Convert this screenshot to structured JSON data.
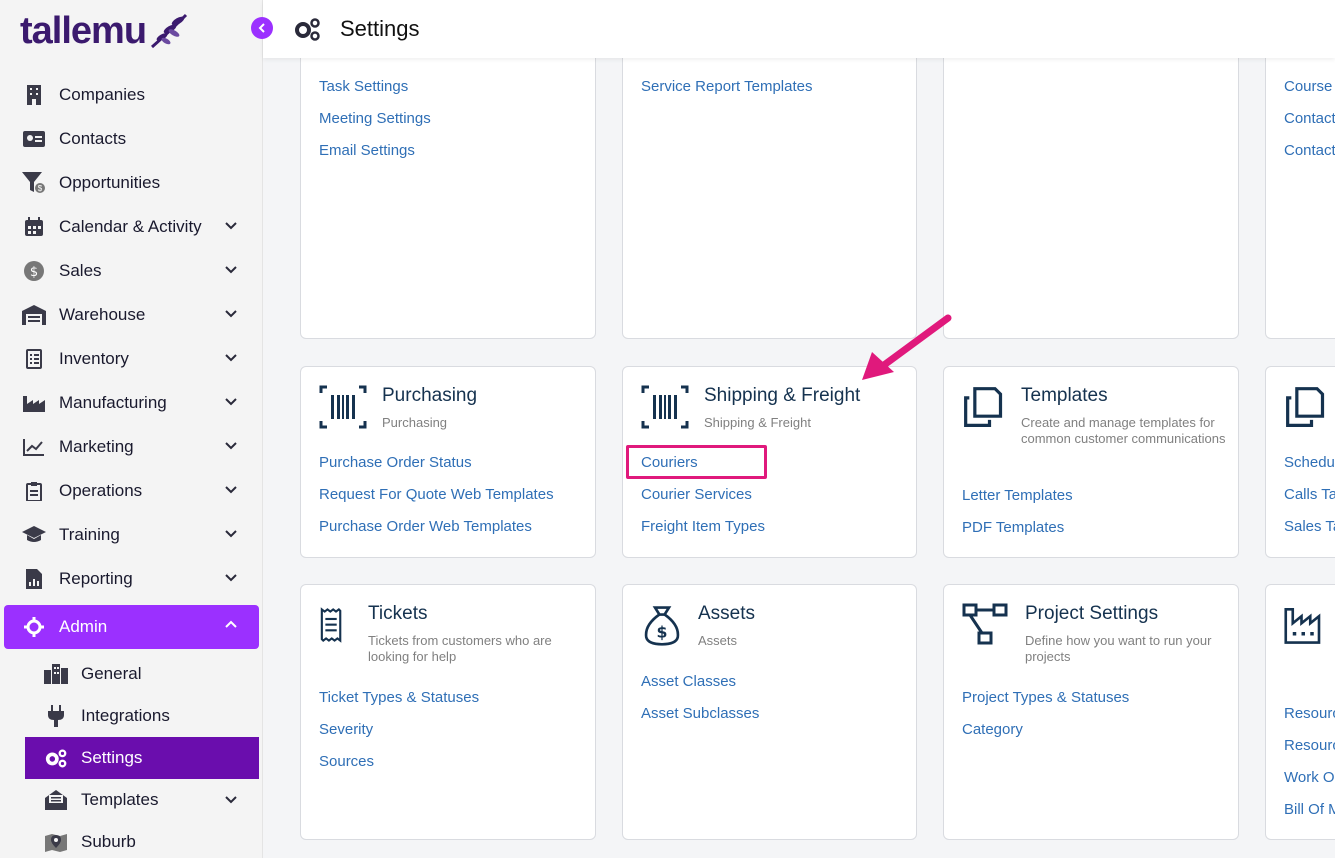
{
  "app": {
    "logo": "tallemu",
    "header_title": "Settings"
  },
  "sidebar": {
    "items": [
      {
        "label": "Companies",
        "icon": "building-icon",
        "expandable": false
      },
      {
        "label": "Contacts",
        "icon": "id-card-icon",
        "expandable": false
      },
      {
        "label": "Opportunities",
        "icon": "funnel-icon",
        "expandable": false
      },
      {
        "label": "Calendar & Activity",
        "icon": "calendar-icon",
        "expandable": true
      },
      {
        "label": "Sales",
        "icon": "dollar-coin-icon",
        "expandable": true
      },
      {
        "label": "Warehouse",
        "icon": "warehouse-icon",
        "expandable": true
      },
      {
        "label": "Inventory",
        "icon": "checklist-icon",
        "expandable": true
      },
      {
        "label": "Manufacturing",
        "icon": "factory-icon",
        "expandable": true
      },
      {
        "label": "Marketing",
        "icon": "trend-chart-icon",
        "expandable": true
      },
      {
        "label": "Operations",
        "icon": "clipboard-icon",
        "expandable": true
      },
      {
        "label": "Training",
        "icon": "graduation-cap-icon",
        "expandable": true
      },
      {
        "label": "Reporting",
        "icon": "report-icon",
        "expandable": true
      }
    ],
    "admin": {
      "label": "Admin",
      "icon": "cog-icon"
    },
    "admin_sub": [
      {
        "label": "General",
        "icon": "city-icon"
      },
      {
        "label": "Integrations",
        "icon": "plug-icon"
      },
      {
        "label": "Settings",
        "icon": "gears-icon"
      },
      {
        "label": "Templates",
        "icon": "envelope-open-icon"
      },
      {
        "label": "Suburb",
        "icon": "map-marker-icon"
      }
    ]
  },
  "cards": {
    "top1": {
      "links": [
        "Task Settings",
        "Meeting Settings",
        "Email Settings"
      ]
    },
    "top2": {
      "links": [
        "Service Report Templates"
      ]
    },
    "top4": {
      "links": [
        "Course",
        "Contact",
        "Contact"
      ]
    },
    "purchasing": {
      "title": "Purchasing",
      "subtitle": "Purchasing",
      "links": [
        "Purchase Order Status",
        "Request For Quote Web Templates",
        "Purchase Order Web Templates"
      ]
    },
    "shipping": {
      "title": "Shipping & Freight",
      "subtitle": "Shipping & Freight",
      "links": [
        "Couriers",
        "Courier Services",
        "Freight Item Types"
      ]
    },
    "templates": {
      "title": "Templates",
      "subtitle": "Create and manage templates for common customer communications",
      "links": [
        "Letter Templates",
        "PDF Templates"
      ]
    },
    "mid4": {
      "links": [
        "Schedul",
        "Calls Ta",
        "Sales Ta"
      ]
    },
    "tickets": {
      "title": "Tickets",
      "subtitle": "Tickets from customers who are looking for help",
      "links": [
        "Ticket Types & Statuses",
        "Severity",
        "Sources"
      ]
    },
    "assets": {
      "title": "Assets",
      "subtitle": "Assets",
      "links": [
        "Asset Classes",
        "Asset Subclasses"
      ]
    },
    "project": {
      "title": "Project Settings",
      "subtitle": "Define how you want to run your projects",
      "links": [
        "Project Types & Statuses",
        "Category"
      ]
    },
    "bot4": {
      "links": [
        "Resourc",
        "Resourc",
        "Work O",
        "Bill Of M"
      ]
    }
  },
  "colors": {
    "accent": "#9b30ff",
    "selected": "#6a0dad",
    "link": "#2f6fb6",
    "highlight": "#e0197c"
  }
}
